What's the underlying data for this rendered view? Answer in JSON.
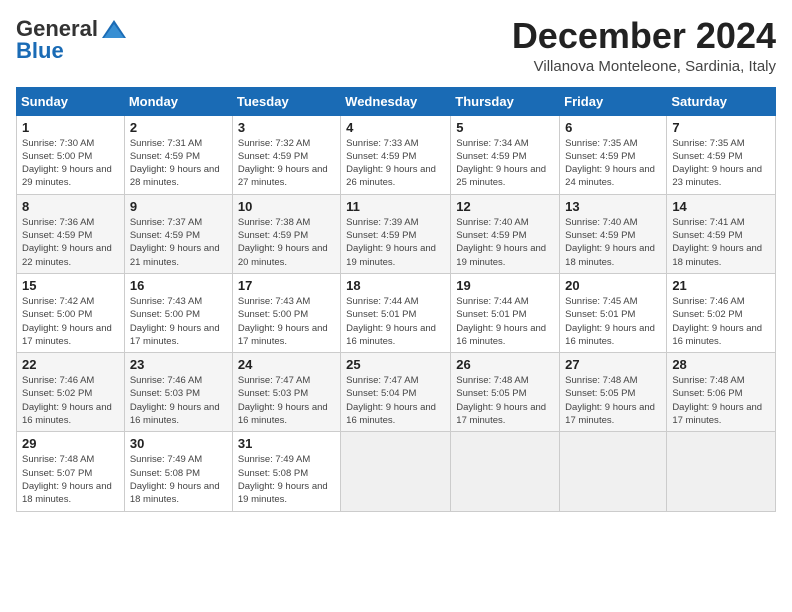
{
  "logo": {
    "general": "General",
    "blue": "Blue"
  },
  "title": "December 2024",
  "location": "Villanova Monteleone, Sardinia, Italy",
  "days_of_week": [
    "Sunday",
    "Monday",
    "Tuesday",
    "Wednesday",
    "Thursday",
    "Friday",
    "Saturday"
  ],
  "weeks": [
    [
      {
        "day": "1",
        "sunrise": "7:30 AM",
        "sunset": "5:00 PM",
        "daylight": "9 hours and 29 minutes."
      },
      {
        "day": "2",
        "sunrise": "7:31 AM",
        "sunset": "4:59 PM",
        "daylight": "9 hours and 28 minutes."
      },
      {
        "day": "3",
        "sunrise": "7:32 AM",
        "sunset": "4:59 PM",
        "daylight": "9 hours and 27 minutes."
      },
      {
        "day": "4",
        "sunrise": "7:33 AM",
        "sunset": "4:59 PM",
        "daylight": "9 hours and 26 minutes."
      },
      {
        "day": "5",
        "sunrise": "7:34 AM",
        "sunset": "4:59 PM",
        "daylight": "9 hours and 25 minutes."
      },
      {
        "day": "6",
        "sunrise": "7:35 AM",
        "sunset": "4:59 PM",
        "daylight": "9 hours and 24 minutes."
      },
      {
        "day": "7",
        "sunrise": "7:35 AM",
        "sunset": "4:59 PM",
        "daylight": "9 hours and 23 minutes."
      }
    ],
    [
      {
        "day": "8",
        "sunrise": "7:36 AM",
        "sunset": "4:59 PM",
        "daylight": "9 hours and 22 minutes."
      },
      {
        "day": "9",
        "sunrise": "7:37 AM",
        "sunset": "4:59 PM",
        "daylight": "9 hours and 21 minutes."
      },
      {
        "day": "10",
        "sunrise": "7:38 AM",
        "sunset": "4:59 PM",
        "daylight": "9 hours and 20 minutes."
      },
      {
        "day": "11",
        "sunrise": "7:39 AM",
        "sunset": "4:59 PM",
        "daylight": "9 hours and 19 minutes."
      },
      {
        "day": "12",
        "sunrise": "7:40 AM",
        "sunset": "4:59 PM",
        "daylight": "9 hours and 19 minutes."
      },
      {
        "day": "13",
        "sunrise": "7:40 AM",
        "sunset": "4:59 PM",
        "daylight": "9 hours and 18 minutes."
      },
      {
        "day": "14",
        "sunrise": "7:41 AM",
        "sunset": "4:59 PM",
        "daylight": "9 hours and 18 minutes."
      }
    ],
    [
      {
        "day": "15",
        "sunrise": "7:42 AM",
        "sunset": "5:00 PM",
        "daylight": "9 hours and 17 minutes."
      },
      {
        "day": "16",
        "sunrise": "7:43 AM",
        "sunset": "5:00 PM",
        "daylight": "9 hours and 17 minutes."
      },
      {
        "day": "17",
        "sunrise": "7:43 AM",
        "sunset": "5:00 PM",
        "daylight": "9 hours and 17 minutes."
      },
      {
        "day": "18",
        "sunrise": "7:44 AM",
        "sunset": "5:01 PM",
        "daylight": "9 hours and 16 minutes."
      },
      {
        "day": "19",
        "sunrise": "7:44 AM",
        "sunset": "5:01 PM",
        "daylight": "9 hours and 16 minutes."
      },
      {
        "day": "20",
        "sunrise": "7:45 AM",
        "sunset": "5:01 PM",
        "daylight": "9 hours and 16 minutes."
      },
      {
        "day": "21",
        "sunrise": "7:46 AM",
        "sunset": "5:02 PM",
        "daylight": "9 hours and 16 minutes."
      }
    ],
    [
      {
        "day": "22",
        "sunrise": "7:46 AM",
        "sunset": "5:02 PM",
        "daylight": "9 hours and 16 minutes."
      },
      {
        "day": "23",
        "sunrise": "7:46 AM",
        "sunset": "5:03 PM",
        "daylight": "9 hours and 16 minutes."
      },
      {
        "day": "24",
        "sunrise": "7:47 AM",
        "sunset": "5:03 PM",
        "daylight": "9 hours and 16 minutes."
      },
      {
        "day": "25",
        "sunrise": "7:47 AM",
        "sunset": "5:04 PM",
        "daylight": "9 hours and 16 minutes."
      },
      {
        "day": "26",
        "sunrise": "7:48 AM",
        "sunset": "5:05 PM",
        "daylight": "9 hours and 17 minutes."
      },
      {
        "day": "27",
        "sunrise": "7:48 AM",
        "sunset": "5:05 PM",
        "daylight": "9 hours and 17 minutes."
      },
      {
        "day": "28",
        "sunrise": "7:48 AM",
        "sunset": "5:06 PM",
        "daylight": "9 hours and 17 minutes."
      }
    ],
    [
      {
        "day": "29",
        "sunrise": "7:48 AM",
        "sunset": "5:07 PM",
        "daylight": "9 hours and 18 minutes."
      },
      {
        "day": "30",
        "sunrise": "7:49 AM",
        "sunset": "5:08 PM",
        "daylight": "9 hours and 18 minutes."
      },
      {
        "day": "31",
        "sunrise": "7:49 AM",
        "sunset": "5:08 PM",
        "daylight": "9 hours and 19 minutes."
      },
      null,
      null,
      null,
      null
    ]
  ]
}
